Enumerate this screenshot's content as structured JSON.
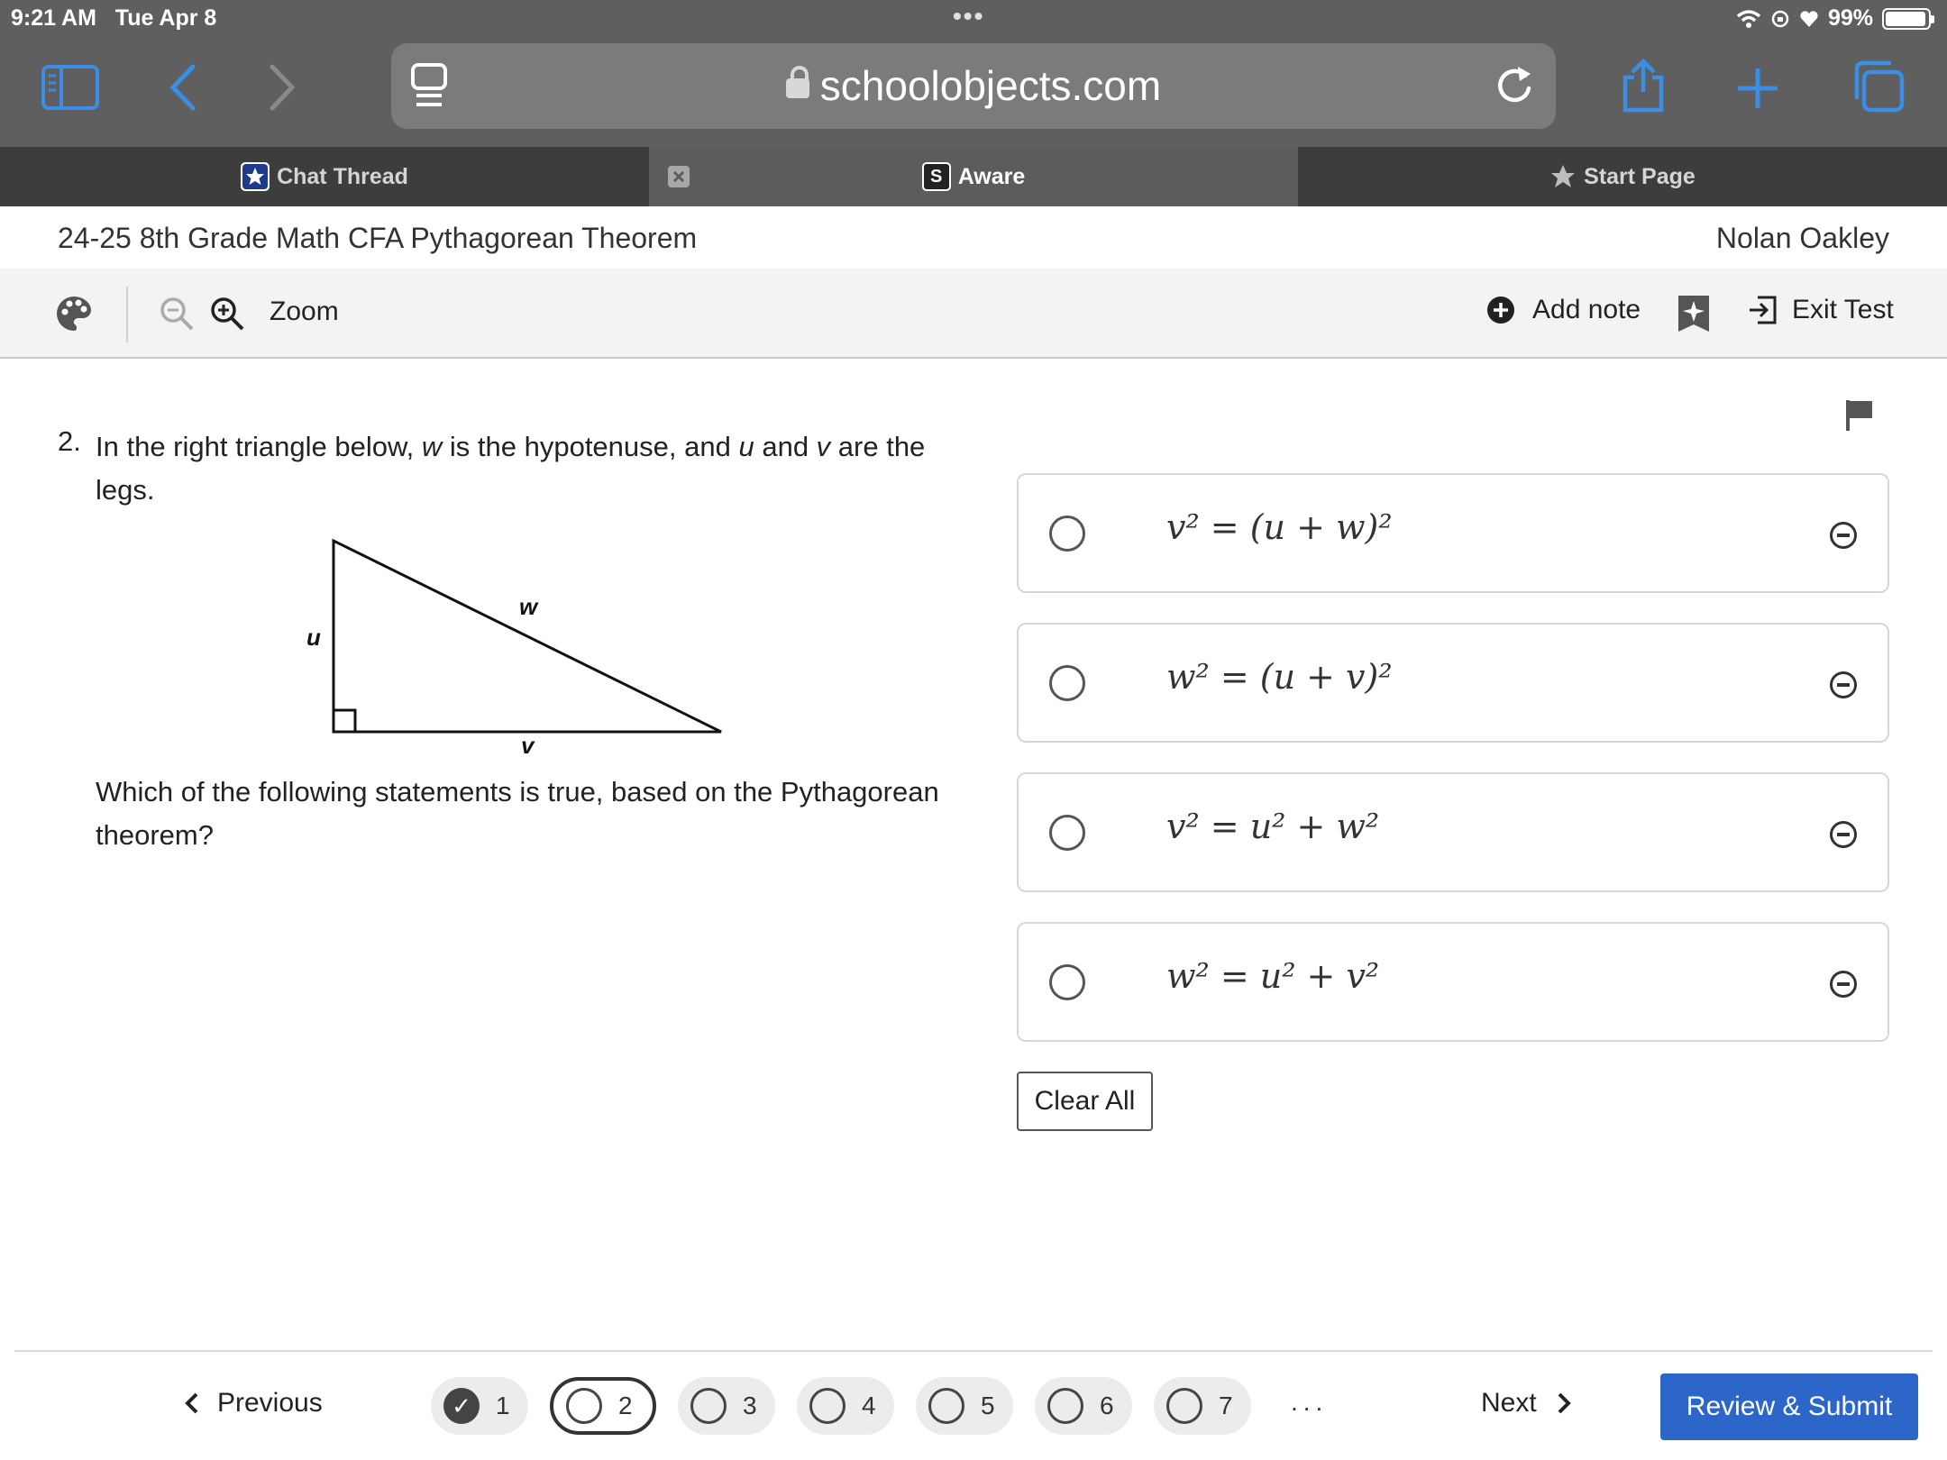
{
  "status_bar": {
    "time": "9:21 AM",
    "date": "Tue Apr 8",
    "dots": "•••",
    "battery": "99%"
  },
  "browser": {
    "url": "schoolobjects.com"
  },
  "tabs": [
    {
      "label": "Chat Thread"
    },
    {
      "label": "Aware"
    },
    {
      "label": "Start Page"
    }
  ],
  "page": {
    "title": "24-25 8th Grade Math CFA Pythagorean Theorem",
    "user": "Nolan Oakley"
  },
  "toolbar": {
    "zoom_label": "Zoom",
    "add_note_label": "Add note",
    "exit_label": "Exit Test"
  },
  "question": {
    "number": "2.",
    "line1_a": "In the right triangle below, ",
    "var_w": "w",
    "line1_b": " is the hypotenuse, and ",
    "var_u": "u",
    "line1_c": " and ",
    "var_v": "v",
    "line1_d": " are the legs.",
    "prompt": "Which of the following statements is true, based on the Pythagorean theorem?",
    "triangle_labels": {
      "hyp": "w",
      "vertical": "u",
      "horizontal": "v"
    }
  },
  "choices": [
    {
      "eq_html": "v² = (u + w)²"
    },
    {
      "eq_html": "w² = (u + v)²"
    },
    {
      "eq_html": "v² = u² + w²"
    },
    {
      "eq_html": "w² = u² + v²"
    }
  ],
  "clear_all": "Clear All",
  "footer": {
    "previous": "Previous",
    "next": "Next",
    "more": "...",
    "submit": "Review & Submit",
    "questions": [
      "1",
      "2",
      "3",
      "4",
      "5",
      "6",
      "7"
    ]
  },
  "colors": {
    "chrome": "#5f5f5f",
    "tabbar": "#3d3d3d",
    "accent": "#2b66c8",
    "ios_blue": "#3a8ee6"
  }
}
